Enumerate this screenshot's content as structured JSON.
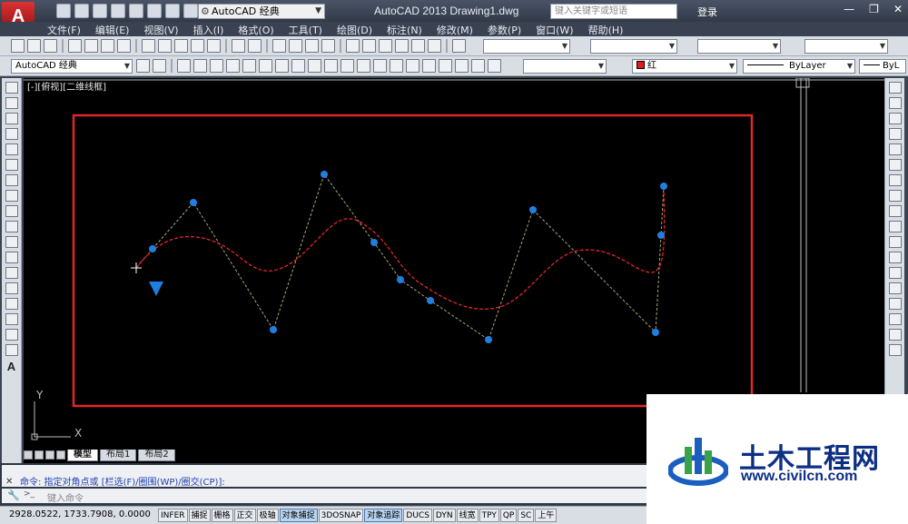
{
  "titlebar": {
    "app_logo": "A",
    "workspace": "AutoCAD 经典",
    "title": "AutoCAD 2013    Drawing1.dwg",
    "search_placeholder": "键入关键字或短语",
    "login": "登录"
  },
  "menu": {
    "items": [
      "文件(F)",
      "编辑(E)",
      "视图(V)",
      "插入(I)",
      "格式(O)",
      "工具(T)",
      "绘图(D)",
      "标注(N)",
      "修改(M)",
      "参数(P)",
      "窗口(W)",
      "帮助(H)"
    ]
  },
  "toolbar2": {
    "text_style": "AutoCAD 经典",
    "color": "红",
    "linetype": "ByLayer",
    "lineweight": "ByL"
  },
  "canvas": {
    "viewport_label": "[-][俯视][二维线框]",
    "bg_color": "#000000",
    "frame_color": "#e0272b",
    "spline_color": "#e0272b",
    "cv_color": "#1e7fe0",
    "ucs_y": "Y",
    "ucs_x": "X"
  },
  "tabs": {
    "items": [
      "模型",
      "布局1",
      "布局2"
    ],
    "active": "模型"
  },
  "command": {
    "history": "命令: 指定对角点或 [栏选(F)/圈围(WP)/圈交(CP)]:",
    "placeholder": "键入命令",
    "prompt": ">_"
  },
  "status": {
    "coordinates": "2928.0522, 1733.7908, 0.0000",
    "buttons": [
      {
        "label": "INFER",
        "on": false
      },
      {
        "label": "捕捉",
        "on": false
      },
      {
        "label": "栅格",
        "on": false
      },
      {
        "label": "正交",
        "on": false
      },
      {
        "label": "极轴",
        "on": false
      },
      {
        "label": "对象捕捉",
        "on": true
      },
      {
        "label": "3DOSNAP",
        "on": false
      },
      {
        "label": "对象追踪",
        "on": true
      },
      {
        "label": "DUCS",
        "on": false
      },
      {
        "label": "DYN",
        "on": false
      },
      {
        "label": "线宽",
        "on": false
      },
      {
        "label": "TPY",
        "on": false
      },
      {
        "label": "QP",
        "on": false
      },
      {
        "label": "SC",
        "on": false
      },
      {
        "label": "上午",
        "on": false
      }
    ]
  },
  "watermark": {
    "title": "土木工程网",
    "url": "www.civilcn.com"
  }
}
